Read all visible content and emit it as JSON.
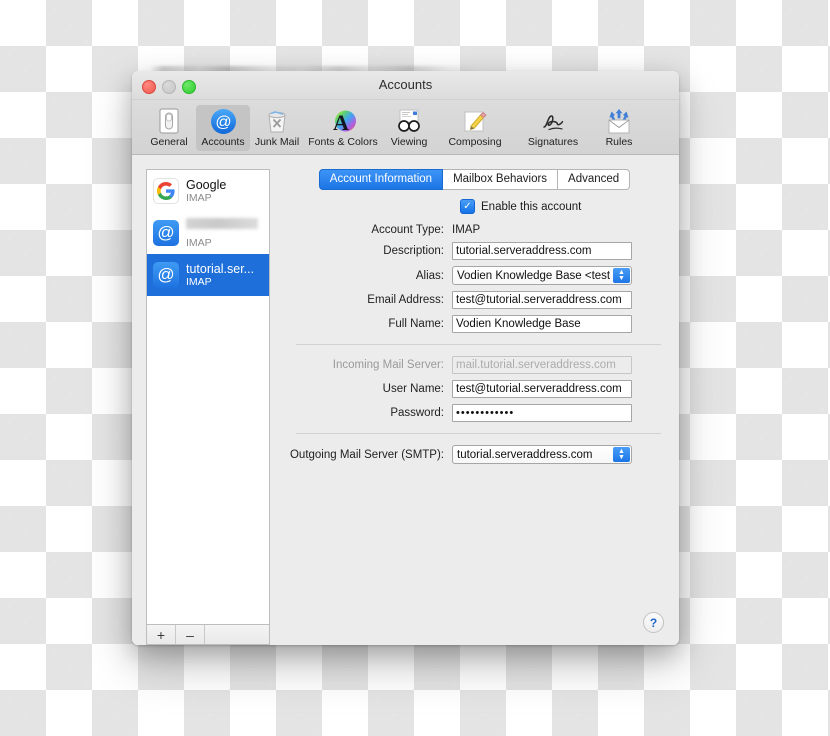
{
  "window": {
    "title": "Accounts",
    "traffic_lights": [
      "close",
      "minimize",
      "zoom"
    ]
  },
  "toolbar": {
    "items": [
      {
        "label": "General",
        "icon": "general-icon",
        "selected": false
      },
      {
        "label": "Accounts",
        "icon": "accounts-at-icon",
        "selected": true
      },
      {
        "label": "Junk Mail",
        "icon": "junk-mail-icon",
        "selected": false
      },
      {
        "label": "Fonts & Colors",
        "icon": "fonts-colors-icon",
        "selected": false
      },
      {
        "label": "Viewing",
        "icon": "viewing-glasses-icon",
        "selected": false
      },
      {
        "label": "Composing",
        "icon": "composing-pencil-icon",
        "selected": false
      },
      {
        "label": "Signatures",
        "icon": "signatures-icon",
        "selected": false
      },
      {
        "label": "Rules",
        "icon": "rules-envelope-icon",
        "selected": false
      }
    ]
  },
  "sidebar": {
    "accounts": [
      {
        "name": "Google",
        "type": "IMAP",
        "icon": "google-logo-icon",
        "selected": false,
        "redacted": false
      },
      {
        "name": "",
        "type": "IMAP",
        "icon": "at-sign-icon",
        "selected": false,
        "redacted": true
      },
      {
        "name": "tutorial.ser...",
        "type": "IMAP",
        "icon": "at-sign-icon",
        "selected": true,
        "redacted": false
      }
    ],
    "add_label": "+",
    "remove_label": "–"
  },
  "tabs": [
    {
      "label": "Account Information",
      "active": true
    },
    {
      "label": "Mailbox Behaviors",
      "active": false
    },
    {
      "label": "Advanced",
      "active": false
    }
  ],
  "form": {
    "enable_checkbox": {
      "label": "Enable this account",
      "checked": true,
      "mark": "✓"
    },
    "account_type": {
      "label": "Account Type:",
      "value": "IMAP"
    },
    "description": {
      "label": "Description:",
      "value": "tutorial.serveraddress.com"
    },
    "alias": {
      "label": "Alias:",
      "value": "Vodien Knowledge Base <test"
    },
    "email_address": {
      "label": "Email Address:",
      "value": "test@tutorial.serveraddress.com"
    },
    "full_name": {
      "label": "Full Name:",
      "value": "Vodien Knowledge Base"
    },
    "incoming_server": {
      "label": "Incoming Mail Server:",
      "value": "mail.tutorial.serveraddress.com",
      "disabled": true
    },
    "user_name": {
      "label": "User Name:",
      "value": "test@tutorial.serveraddress.com"
    },
    "password": {
      "label": "Password:",
      "value": "••••••••••••"
    },
    "outgoing_server": {
      "label": "Outgoing Mail Server (SMTP):",
      "value": "tutorial.serveraddress.com"
    }
  },
  "help": {
    "label": "?"
  },
  "colors": {
    "accent_blue": "#1e6fd9",
    "tab_active": "#2b80ef",
    "window_bg": "#ececec",
    "toolbar_bg": "#d6d6d6"
  }
}
